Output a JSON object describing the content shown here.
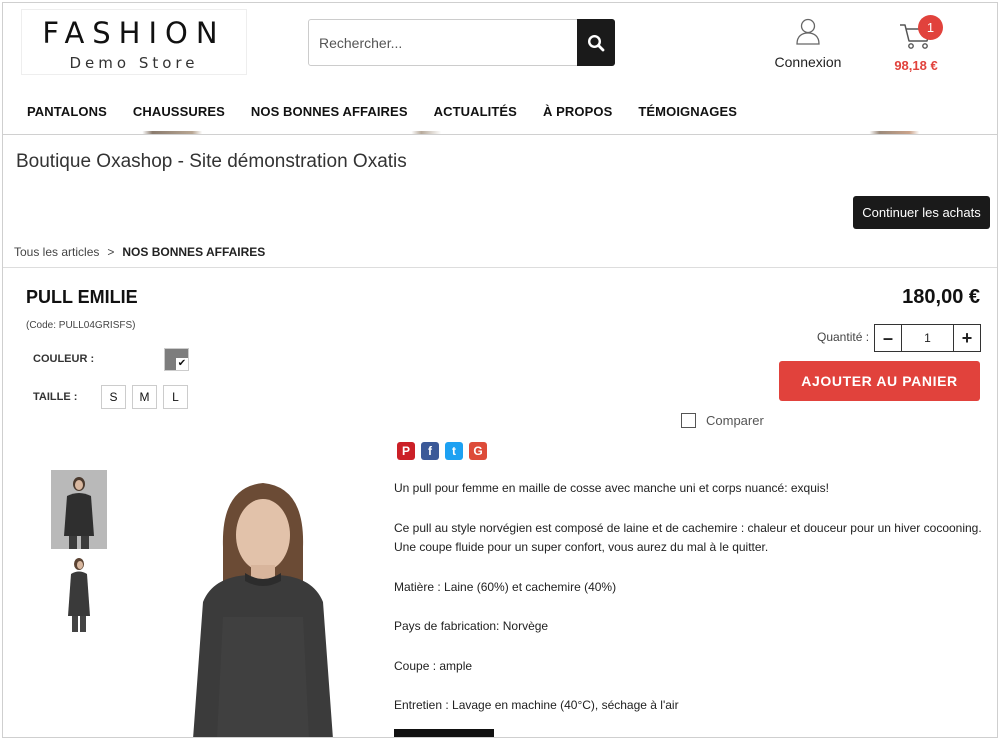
{
  "header": {
    "logo_line1": "FASHION",
    "logo_line2": "Demo Store",
    "search_placeholder": "Rechercher...",
    "login_label": "Connexion",
    "cart_count": "1",
    "cart_total": "98,18 €"
  },
  "nav": [
    "PANTALONS",
    "CHAUSSURES",
    "NOS BONNES AFFAIRES",
    "ACTUALITÉS",
    "À PROPOS",
    "TÉMOIGNAGES"
  ],
  "page": {
    "site_title": "Boutique Oxashop - Site démonstration Oxatis",
    "continue_label": "Continuer les achats",
    "breadcrumb": {
      "root": "Tous les articles",
      "sep": ">",
      "current": "NOS BONNES AFFAIRES"
    }
  },
  "product": {
    "name": "PULL EMILIE",
    "code": "(Code: PULL04GRISFS)",
    "price": "180,00 €",
    "color_label": "COULEUR :",
    "size_label": "TAILLE :",
    "sizes": [
      "S",
      "M",
      "L"
    ],
    "swatch_color": "#7d7d7d",
    "quantity_label": "Quantité :",
    "quantity_value": "1",
    "add_to_cart_label": "AJOUTER AU PANIER",
    "compare_label": "Comparer"
  },
  "description": [
    "Un pull pour femme en maille de cosse avec manche uni et corps nuancé: exquis!",
    "Ce pull au style norvégien est composé de laine et de cachemire : chaleur et douceur pour un hiver cocooning. Une coupe fluide pour un super confort, vous aurez du mal à le quitter.",
    "Matière : Laine (60%) et cachemire (40%)",
    "Pays de fabrication: Norvège",
    "Coupe : ample",
    "Entretien : Lavage en machine (40°C), séchage à l'air"
  ],
  "social": [
    "pinterest-icon",
    "facebook-icon",
    "twitter-icon",
    "google-plus-icon"
  ],
  "colors": {
    "accent": "#e1423c",
    "dark": "#1a1a1a"
  }
}
